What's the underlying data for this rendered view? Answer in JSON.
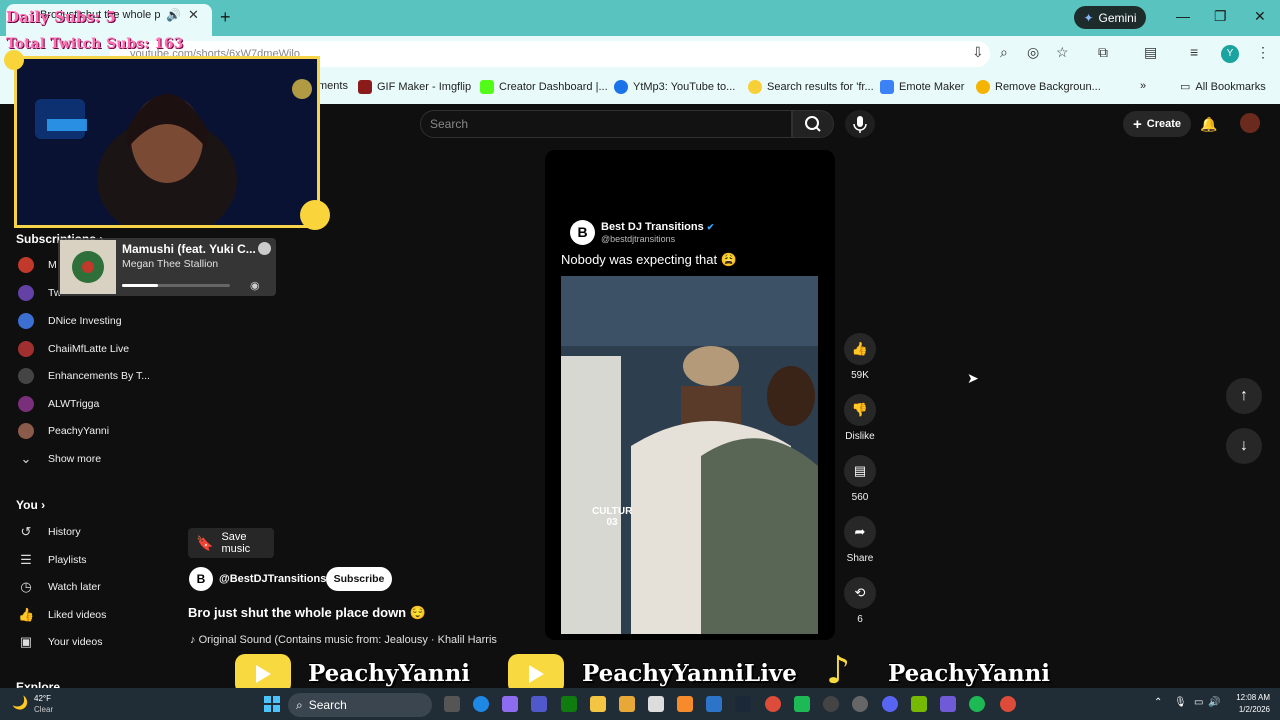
{
  "browser": {
    "tab_title": "Bro just shut the whole place down",
    "url": "youtube.com/shorts/6xW7dmeWilo",
    "gemini_label": "Gemini",
    "profile_initial": "Y",
    "bookmarks": [
      "ments",
      "GIF Maker - Imgflip",
      "Creator Dashboard |...",
      "YtMp3: YouTube to...",
      "Search results for 'fr...",
      "Emote Maker",
      "Remove Backgroun..."
    ],
    "all_bookmarks": "All Bookmarks"
  },
  "stream_overlay": {
    "daily_subs": "Daily Subs: 5",
    "total_subs": "Total Twitch Subs: 163",
    "socials": [
      "PeachyYanni",
      "PeachyYanniLive",
      "PeachyYanni"
    ]
  },
  "spotify": {
    "title": "Mamushi (feat. Yuki C...",
    "artist": "Megan Thee Stallion",
    "progress": 0.33
  },
  "sidebar": {
    "subscriptions_label": "Subscriptions",
    "subscriptions": [
      {
        "label": "M",
        "color": "#c0392b"
      },
      {
        "label": "Tw",
        "color": "#6441a5"
      },
      {
        "label": "DNice Investing",
        "color": "#3b6fd1"
      },
      {
        "label": "ChaiiMfLatte Live",
        "color": "#a03030"
      },
      {
        "label": "Enhancements By T...",
        "color": "#444444"
      },
      {
        "label": "ALWTrigga",
        "color": "#7a2f7a"
      },
      {
        "label": "PeachyYanni",
        "color": "#8a5a4a"
      }
    ],
    "show_more": "Show more",
    "you_label": "You",
    "you_items": [
      {
        "label": "History",
        "icon": "history-icon"
      },
      {
        "label": "Playlists",
        "icon": "playlists-icon"
      },
      {
        "label": "Watch later",
        "icon": "watch-later-icon"
      },
      {
        "label": "Liked videos",
        "icon": "like-icon"
      },
      {
        "label": "Your videos",
        "icon": "your-videos-icon"
      }
    ],
    "explore_label": "Explore"
  },
  "youtube": {
    "search_placeholder": "Search",
    "create_label": "Create"
  },
  "short": {
    "channel_name": "Best DJ Transitions",
    "channel_handle": "@bestdjtransitions",
    "caption": "Nobody was expecting that 😩",
    "watermark": "CULTUR 03",
    "actions": {
      "likes": "59K",
      "dislike": "Dislike",
      "comments": "560",
      "share": "Share",
      "remix": "6"
    },
    "save_music": "Save music",
    "channel_at": "@BestDJTransitions",
    "subscribe": "Subscribe",
    "title": "Bro just shut the whole place down 😌",
    "sound": "Original Sound (Contains music from: Jealousy · Khalil Harris"
  },
  "taskbar": {
    "temp": "42°F",
    "weather": "Clear",
    "search": "Search",
    "time": "12:08 AM",
    "date": "1/2/2026"
  }
}
